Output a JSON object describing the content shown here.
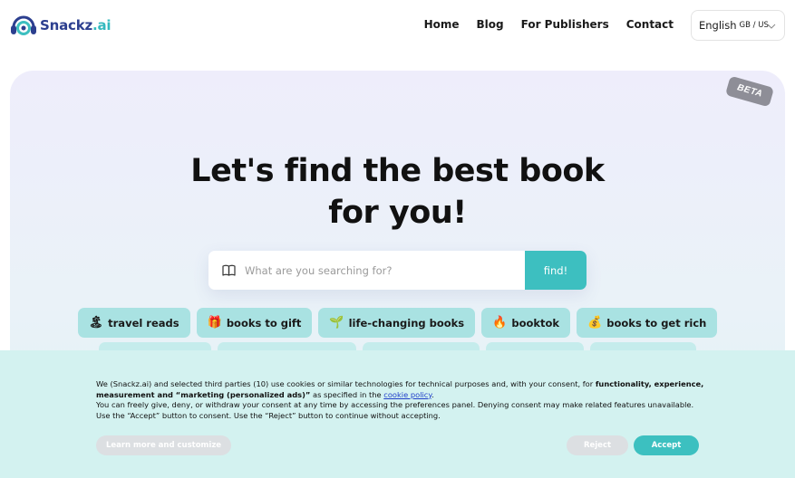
{
  "brand": {
    "name_main": "Snackz",
    "name_suffix": ".ai"
  },
  "nav": {
    "items": [
      {
        "label": "Home"
      },
      {
        "label": "Blog"
      },
      {
        "label": "For Publishers"
      },
      {
        "label": "Contact"
      }
    ]
  },
  "language": {
    "label": "English",
    "region": "GB / US"
  },
  "hero": {
    "badge": "BETA",
    "title_line1": "Let's find the best book",
    "title_line2": "for you!"
  },
  "search": {
    "placeholder": "What are you searching for?",
    "value": "",
    "button_label": "find!"
  },
  "chips": [
    {
      "emoji": "🏝",
      "label": "travel reads"
    },
    {
      "emoji": "🎁",
      "label": "books to gift"
    },
    {
      "emoji": "🌱",
      "label": "life-changing books"
    },
    {
      "emoji": "🔥",
      "label": "booktok"
    },
    {
      "emoji": "💰",
      "label": "books to get rich"
    }
  ],
  "cookie": {
    "line1_start": "We (Snackz.ai) and selected third parties (10) use cookies or similar technologies for technical purposes and, with your consent, for ",
    "line1_bold": "functionality, experience, measurement and “marketing (personalized ads)”",
    "line1_mid": " as specified in the ",
    "policy_link": "cookie policy",
    "line1_end": ".",
    "line2": "You can freely give, deny, or withdraw your consent at any time by accessing the preferences panel. Denying consent may make related features unavailable.",
    "line3": "Use the “Accept” button to consent. Use the “Reject” button to continue without accepting.",
    "learn_label": "Learn more and customize",
    "reject_label": "Reject",
    "accept_label": "Accept"
  },
  "colors": {
    "accent": "#3dbfc0",
    "chip": "#a9e2e2",
    "brand_blue": "#2c3f8f",
    "banner": "#d3f2f0"
  }
}
